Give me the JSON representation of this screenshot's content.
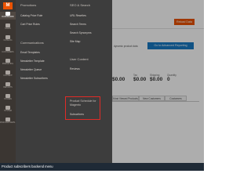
{
  "sidebar": {
    "logo": "M",
    "items": [
      {
        "label": "DASHBOARD",
        "icon": "dashboard-icon",
        "active": true
      },
      {
        "label": "SALES",
        "icon": "dollar-icon",
        "active": false
      },
      {
        "label": "CATALOG",
        "icon": "box-icon",
        "active": false
      },
      {
        "label": "CUSTOMERS",
        "icon": "user-icon",
        "active": false
      },
      {
        "label": "MARKETING",
        "icon": "megaphone-icon",
        "active": false
      },
      {
        "label": "CONTENT",
        "icon": "layout-icon",
        "active": false
      },
      {
        "label": "REPORTS",
        "icon": "bar-chart-icon",
        "active": false
      },
      {
        "label": "STORES",
        "icon": "store-icon",
        "active": false
      },
      {
        "label": "SYSTEM",
        "icon": "gear-icon",
        "active": false
      },
      {
        "label": "FIND PARTNERS & EXTENSIONS",
        "icon": "puzzle-icon",
        "active": false
      }
    ]
  },
  "flyout": {
    "promotions": {
      "heading": "Promotions",
      "links": [
        "Catalog Price Rule",
        "Cart Price Rules"
      ]
    },
    "communications": {
      "heading": "Communications",
      "links": [
        "Email Templates",
        "Newsletter Template",
        "Newsletter Queue",
        "Newsletter Subscribers"
      ]
    },
    "seo": {
      "heading": "SEO & Search",
      "links": [
        "URL Rewrites",
        "Search Terms",
        "Search Synonyms",
        "Site Map"
      ]
    },
    "user_content": {
      "heading": "User Content",
      "links": [
        "Reviews"
      ]
    },
    "product_scheduler": {
      "heading": "Product Schedule for Magento",
      "links": [
        "Subscribers"
      ]
    }
  },
  "main": {
    "top_button": "Reload Data",
    "info_text": "dynamic product data",
    "advanced_button": "Go to Advanced Reporting",
    "stats": [
      {
        "label": "Tax",
        "value": "$0.00"
      },
      {
        "label": "Shipping",
        "value": "$0.00"
      },
      {
        "label": "Quantity",
        "value": "0"
      }
    ],
    "stat_partial": "$0.00",
    "tabs": [
      "Most Viewed Products",
      "New Customers",
      "Customers"
    ]
  },
  "caption": "Product subscribers backend menu",
  "colors": {
    "sidebar_bg": "#3b3632",
    "flyout_bg": "#3d3d3d",
    "accent_orange": "#eb5202",
    "button_blue": "#1979c3",
    "highlight_red": "#e02b27"
  }
}
